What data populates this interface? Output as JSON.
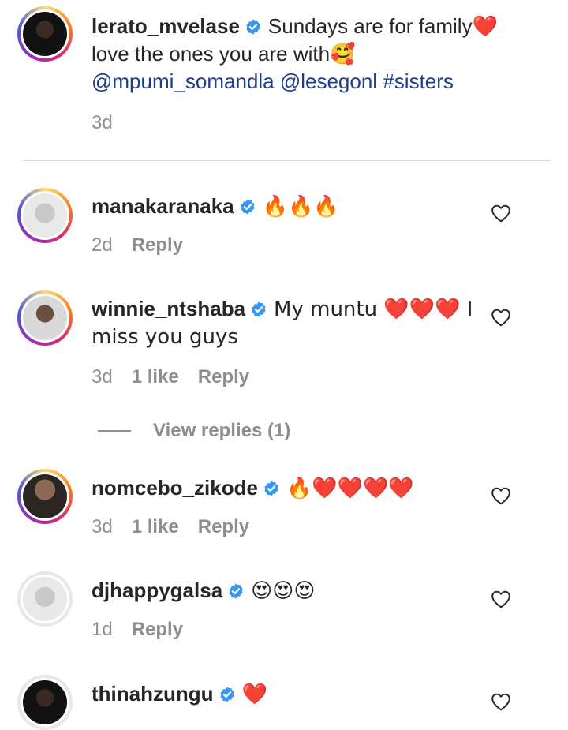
{
  "post": {
    "username": "lerato_mvelase",
    "caption_text": "Sundays are for family",
    "caption_emoji_1": "❤️",
    "caption_line2": "love the ones you are with",
    "caption_emoji_2": "🥰",
    "mention_1": "@mpumi_somandla",
    "mention_2": "@lesegonl",
    "hashtag": "#sisters",
    "time": "3d"
  },
  "comments": [
    {
      "username": "manakaranaka",
      "text": "🔥🔥🔥",
      "time": "2d",
      "likes": "",
      "reply_label": "Reply"
    },
    {
      "username": "winnie_ntshaba",
      "text": "My muntu ❤️❤️❤️ I miss you guys",
      "time": "3d",
      "likes": "1 like",
      "reply_label": "Reply",
      "view_replies": "View replies (1)"
    },
    {
      "username": "nomcebo_zikode",
      "text": "🔥❤️❤️❤️❤️",
      "time": "3d",
      "likes": "1 like",
      "reply_label": "Reply"
    },
    {
      "username": "djhappygalsa",
      "text": "😍😍😍",
      "time": "1d",
      "likes": "",
      "reply_label": "Reply"
    },
    {
      "username": "thinahzungu",
      "text": "❤️",
      "time": "",
      "likes": "",
      "reply_label": ""
    }
  ],
  "colors": {
    "verified": "#3897f0",
    "text": "#262626",
    "meta": "#8e8e8e",
    "mention": "#1e3c8c",
    "divider": "#dbdbdb"
  },
  "icons": {
    "verified": "verified-badge-icon",
    "like": "heart-outline-icon"
  }
}
